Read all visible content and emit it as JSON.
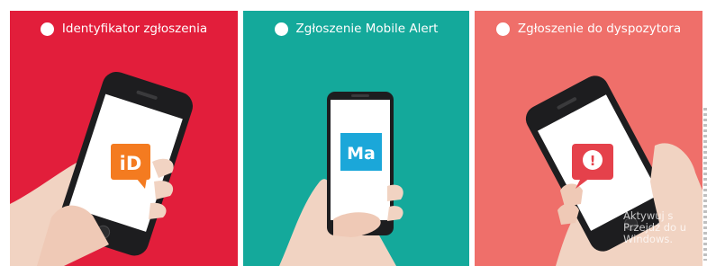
{
  "panels": [
    {
      "title": "Identyfikator zgłoszenia",
      "background": "#e21e3b",
      "app_icon": {
        "name": "id-speech-bubble-icon",
        "text": "iD",
        "color": "#f47b20"
      }
    },
    {
      "title": "Zgłoszenie Mobile Alert",
      "background": "#14a99b",
      "app_icon": {
        "name": "ma-square-icon",
        "text": "Ma",
        "color": "#1ba7d9"
      }
    },
    {
      "title": "Zgłoszenie do dyspozytora",
      "background": "#ef6f6a",
      "app_icon": {
        "name": "alert-speech-bubble-icon",
        "text": "!",
        "color": "#e5414b"
      }
    }
  ],
  "watermark": {
    "line1": "Aktywuj s",
    "line2": "Przejdź do u",
    "line3": "Windows."
  }
}
